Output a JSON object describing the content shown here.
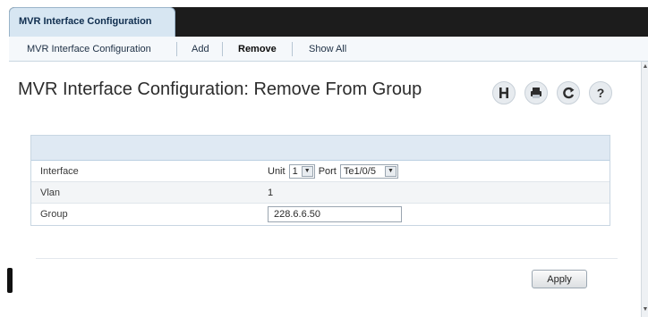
{
  "tab": {
    "title": "MVR Interface Configuration"
  },
  "subnav": {
    "items": [
      {
        "label": "MVR Interface Configuration"
      },
      {
        "label": "Add"
      },
      {
        "label": "Remove"
      },
      {
        "label": "Show All"
      }
    ],
    "active_index": 2
  },
  "page": {
    "title": "MVR Interface Configuration: Remove From Group",
    "toolbar": [
      {
        "icon": "save-icon"
      },
      {
        "icon": "print-icon"
      },
      {
        "icon": "refresh-icon"
      },
      {
        "icon": "help-icon"
      }
    ]
  },
  "form": {
    "interface": {
      "label": "Interface",
      "unit_label": "Unit",
      "unit_value": "1",
      "port_label": "Port",
      "port_value": "Te1/0/5"
    },
    "vlan": {
      "label": "Vlan",
      "value": "1"
    },
    "group": {
      "label": "Group",
      "value": "228.6.6.50"
    }
  },
  "actions": {
    "apply_label": "Apply"
  },
  "colors": {
    "tabbar": "#1c1c1c",
    "tab_active": "#d7e6f2",
    "header_row": "#dfe9f3"
  }
}
